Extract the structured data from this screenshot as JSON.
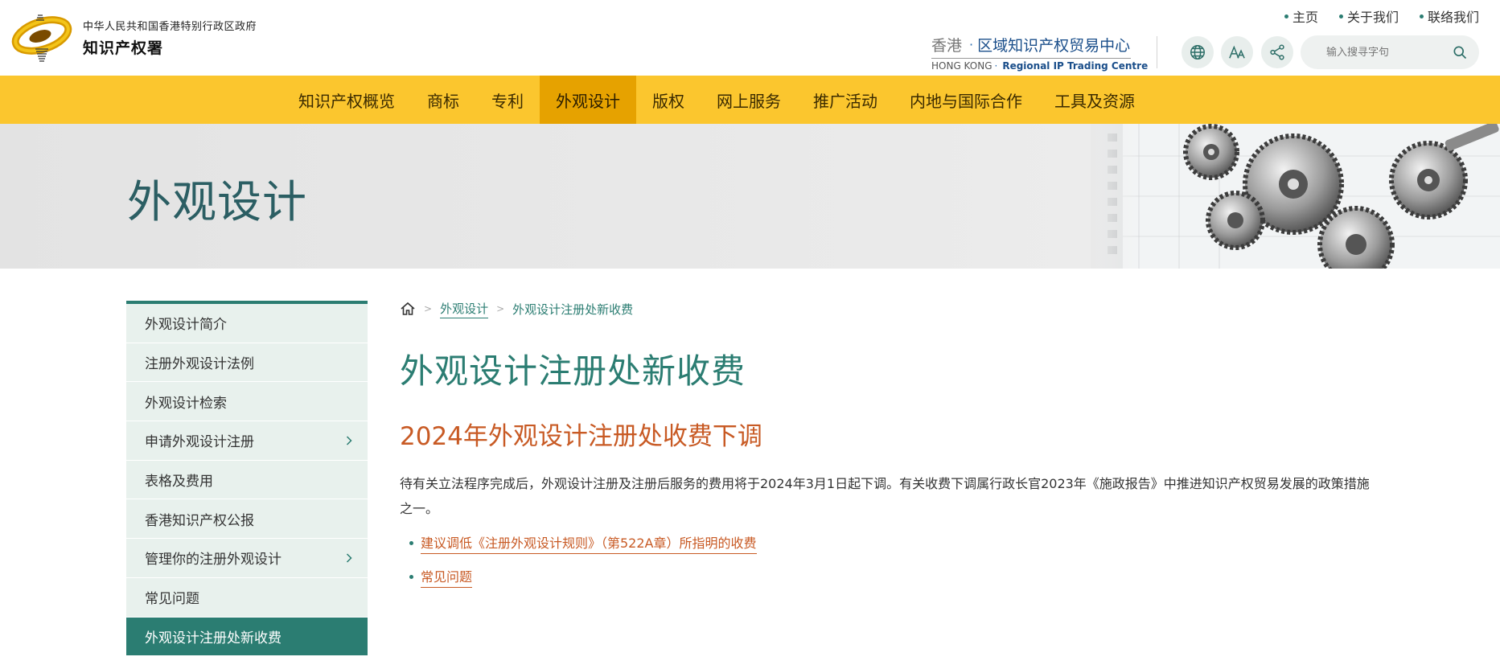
{
  "header": {
    "gov_name": "中华人民共和国香港特别行政区政府",
    "dept_name": "知识产权署",
    "top_links": [
      {
        "label": "主页"
      },
      {
        "label": "关于我们"
      },
      {
        "label": "联络我们"
      }
    ],
    "iptc": {
      "hk_cn": "香港",
      "dot": "·",
      "centre_cn": "区域知识产权贸易中心",
      "hk_en": "HONG KONG",
      "centre_en": "Regional IP Trading Centre"
    },
    "search_placeholder": "输入搜寻字句"
  },
  "nav": {
    "items": [
      {
        "label": "知识产权概览"
      },
      {
        "label": "商标"
      },
      {
        "label": "专利"
      },
      {
        "label": "外观设计",
        "active": true
      },
      {
        "label": "版权"
      },
      {
        "label": "网上服务"
      },
      {
        "label": "推广活动"
      },
      {
        "label": "内地与国际合作"
      },
      {
        "label": "工具及资源"
      }
    ]
  },
  "banner": {
    "title": "外观设计"
  },
  "sidebar": {
    "items": [
      {
        "label": "外观设计简介"
      },
      {
        "label": "注册外观设计法例"
      },
      {
        "label": "外观设计检索"
      },
      {
        "label": "申请外观设计注册",
        "has_children": true
      },
      {
        "label": "表格及费用"
      },
      {
        "label": "香港知识产权公报"
      },
      {
        "label": "管理你的注册外观设计",
        "has_children": true
      },
      {
        "label": "常见问题"
      },
      {
        "label": "外观设计注册处新收费",
        "active": true
      }
    ]
  },
  "breadcrumb": {
    "parent": "外观设计",
    "current": "外观设计注册处新收费"
  },
  "main": {
    "title": "外观设计注册处新收费",
    "subtitle": "2024年外观设计注册处收费下调",
    "paragraph": "待有关立法程序完成后，外观设计注册及注册后服务的费用将于2024年3月1日起下调。有关收费下调属行政长官2023年《施政报告》中推进知识产权贸易发展的政策措施之一。",
    "links": [
      {
        "label": "建议调低《注册外观设计规则》（第522A章）所指明的收费"
      },
      {
        "label": "常见问题"
      }
    ]
  },
  "colors": {
    "nav_bg": "#fbc62e",
    "nav_active": "#e6a200",
    "accent_teal": "#2b7d72",
    "accent_orange": "#c85a24"
  }
}
